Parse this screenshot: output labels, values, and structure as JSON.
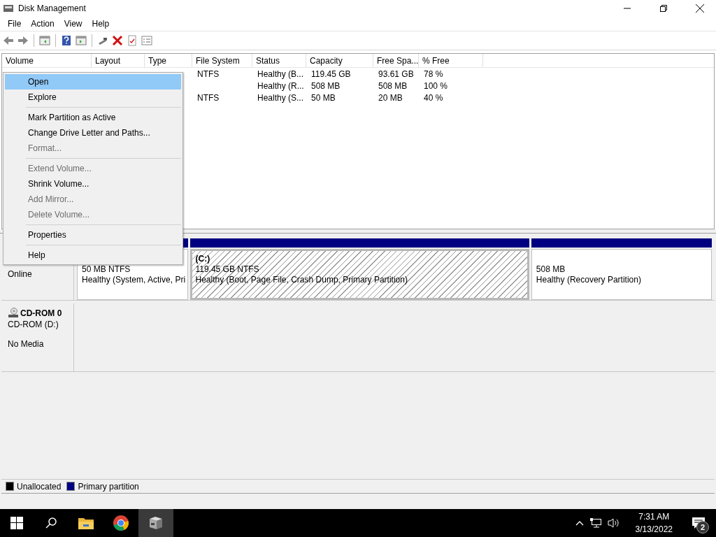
{
  "window": {
    "title": "Disk Management"
  },
  "menu_bar": [
    "File",
    "Action",
    "View",
    "Help"
  ],
  "table": {
    "columns": [
      "Volume",
      "Layout",
      "Type",
      "File System",
      "Status",
      "Capacity",
      "Free Spa...",
      "% Free"
    ],
    "rows": [
      {
        "file_system": "NTFS",
        "status": "Healthy (B...",
        "capacity": "119.45 GB",
        "free_space": "93.61 GB",
        "percent_free": "78 %"
      },
      {
        "status": "Healthy (R...",
        "capacity": "508 MB",
        "free_space": "508 MB",
        "percent_free": "100 %"
      },
      {
        "file_system": "NTFS",
        "status": "Healthy (S...",
        "capacity": "50 MB",
        "free_space": "20 MB",
        "percent_free": "40 %"
      }
    ]
  },
  "context_menu": {
    "items": [
      {
        "kind": "item",
        "label": "Open",
        "selected": true,
        "disabled": false
      },
      {
        "kind": "item",
        "label": "Explore",
        "selected": false,
        "disabled": false
      },
      {
        "kind": "separator"
      },
      {
        "kind": "item",
        "label": "Mark Partition as Active",
        "selected": false,
        "disabled": false
      },
      {
        "kind": "item",
        "label": "Change Drive Letter and Paths...",
        "selected": false,
        "disabled": false
      },
      {
        "kind": "item",
        "label": "Format...",
        "selected": false,
        "disabled": true
      },
      {
        "kind": "separator"
      },
      {
        "kind": "item",
        "label": "Extend Volume...",
        "selected": false,
        "disabled": true
      },
      {
        "kind": "item",
        "label": "Shrink Volume...",
        "selected": false,
        "disabled": false
      },
      {
        "kind": "item",
        "label": "Add Mirror...",
        "selected": false,
        "disabled": true
      },
      {
        "kind": "item",
        "label": "Delete Volume...",
        "selected": false,
        "disabled": true
      },
      {
        "kind": "separator"
      },
      {
        "kind": "item",
        "label": "Properties",
        "selected": false,
        "disabled": false
      },
      {
        "kind": "separator"
      },
      {
        "kind": "item",
        "label": "Help",
        "selected": false,
        "disabled": false
      }
    ]
  },
  "disks": [
    {
      "kind": "disk",
      "state": "Online",
      "partitions": [
        {
          "size": "50 MB NTFS",
          "status": "Healthy (System, Active, Pri",
          "selected": false
        },
        {
          "title": "(C:)",
          "size": "119.45 GB NTFS",
          "status": "Healthy (Boot, Page File, Crash Dump, Primary Partition)",
          "selected": true
        },
        {
          "size": "508 MB",
          "status": "Healthy (Recovery Partition)",
          "selected": false
        }
      ]
    },
    {
      "kind": "cdrom",
      "name": "CD-ROM 0",
      "type": "CD-ROM (D:)",
      "state": "No Media"
    }
  ],
  "legend": [
    {
      "label": "Unallocated",
      "color": "#000000"
    },
    {
      "label": "Primary partition",
      "color": "#000080"
    }
  ],
  "taskbar": {
    "apps": [
      {
        "kind": "folder",
        "selected": false
      },
      {
        "kind": "browser",
        "selected": false
      },
      {
        "kind": "disk",
        "selected": true
      }
    ],
    "time": "7:31 AM",
    "date": "3/13/2022",
    "notifications": "2"
  }
}
